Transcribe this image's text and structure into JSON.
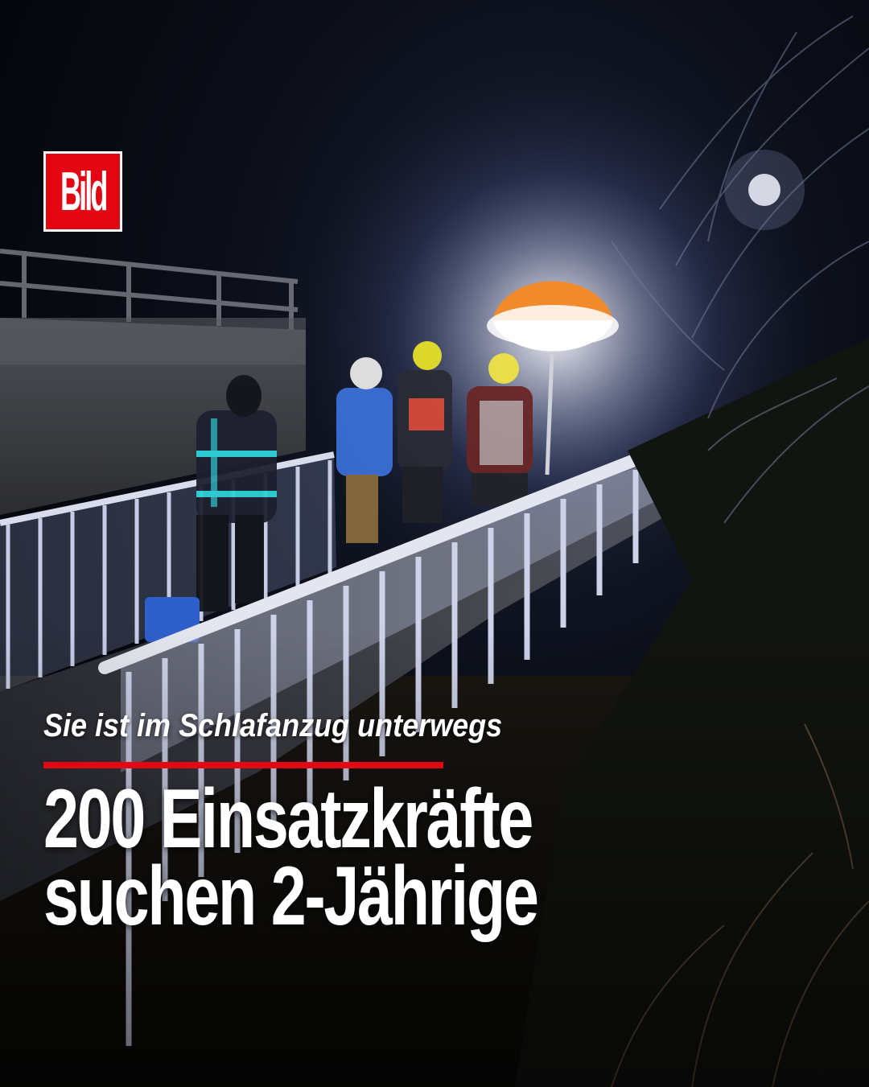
{
  "logo": {
    "text": "Bild"
  },
  "story": {
    "kicker": "Sie ist im Schlafanzug unterwegs",
    "headline_lines": [
      "200 Einsatzkräfte",
      "suchen 2-Jährige"
    ]
  },
  "colors": {
    "brand_red": "#e30613",
    "text": "#ffffff"
  }
}
